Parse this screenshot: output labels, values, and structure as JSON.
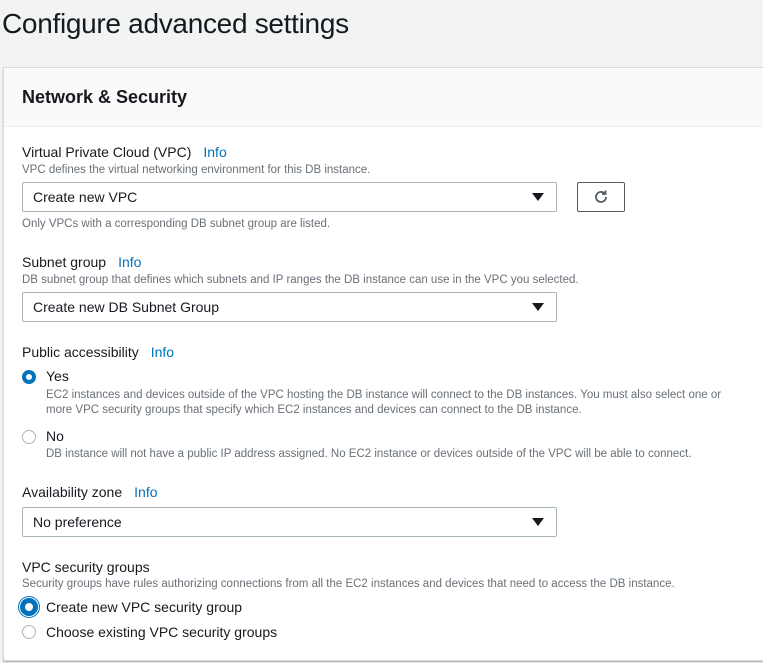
{
  "page_title": "Configure advanced settings",
  "section_title": "Network & Security",
  "info_label": "Info",
  "vpc": {
    "label": "Virtual Private Cloud (VPC)",
    "description": "VPC defines the virtual networking environment for this DB instance.",
    "value": "Create new VPC",
    "hint": "Only VPCs with a corresponding DB subnet group are listed."
  },
  "subnet": {
    "label": "Subnet group",
    "description": "DB subnet group that defines which subnets and IP ranges the DB instance can use in the VPC you selected.",
    "value": "Create new DB Subnet Group"
  },
  "public": {
    "label": "Public accessibility",
    "options": [
      {
        "label": "Yes",
        "selected": true,
        "description": "EC2 instances and devices outside of the VPC hosting the DB instance will connect to the DB instances. You must also select one or more VPC security groups that specify which EC2 instances and devices can connect to the DB instance."
      },
      {
        "label": "No",
        "selected": false,
        "description": "DB instance will not have a public IP address assigned. No EC2 instance or devices outside of the VPC will be able to connect."
      }
    ]
  },
  "az": {
    "label": "Availability zone",
    "value": "No preference"
  },
  "sg": {
    "label": "VPC security groups",
    "description": "Security groups have rules authorizing connections from all the EC2 instances and devices that need to access the DB instance.",
    "options": [
      {
        "label": "Create new VPC security group",
        "selected": true
      },
      {
        "label": "Choose existing VPC security groups",
        "selected": false
      }
    ]
  }
}
